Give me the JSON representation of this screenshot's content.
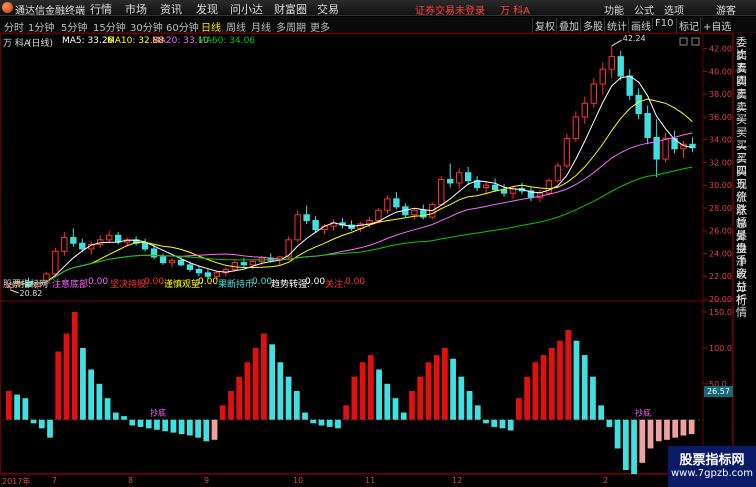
{
  "app": {
    "title": "通达信金融终端"
  },
  "menu": [
    "行情",
    "市场",
    "资讯",
    "发现",
    "问小达",
    "财富圈",
    "交易"
  ],
  "warning": "证券交易未登录",
  "stock_name_top": "万 科A",
  "right_menu": [
    "功能",
    "公式",
    "选项"
  ],
  "user_label": "游客",
  "period_tabs": [
    "分时",
    "1分钟",
    "5分钟",
    "15分钟",
    "30分钟",
    "60分钟",
    "日线",
    "周线",
    "月线",
    "多周期",
    "更多"
  ],
  "active_tab": "日线",
  "tools": [
    "复权",
    "叠加",
    "多股",
    "统计",
    "画线",
    "F10",
    "标记",
    "+自选"
  ],
  "ma_legend": {
    "stock": "万 科A",
    "period": "(日线)",
    "ma5": "MA5: 33.26",
    "ma10": "MA10: 32.88",
    "ma20": "MA20: 33.10",
    "ma60": "MA60: 34.06"
  },
  "indicator_legend": {
    "name": "股票指标网",
    "items": [
      {
        "label": "注意底部:",
        "value": "0.00",
        "color": "#ff66ff"
      },
      {
        "label": "坚决持股:",
        "value": "0.00",
        "color": "#ff3030"
      },
      {
        "label": "谨慎观望:",
        "value": "0.00",
        "color": "#ffff00"
      },
      {
        "label": "果断持币:",
        "value": "0.00",
        "color": "#40e0e0"
      },
      {
        "label": "趋势转强:",
        "value": "0.00",
        "color": "#ffffff"
      },
      {
        "label": "关注:",
        "value": "0.00",
        "color": "#ff3030"
      }
    ]
  },
  "price_axis": [
    "42.00",
    "40.00",
    "38.00",
    "36.00",
    "34.00",
    "32.00",
    "30.00",
    "28.00",
    "26.00",
    "24.00",
    "22.00",
    "20.00"
  ],
  "price_high_label": "42.24",
  "price_low_label": "20.82",
  "indicator_axis": [
    "150.0",
    "100.0",
    "50.0"
  ],
  "indicator_current": "26.57",
  "indicator_zero_markers": [
    "抄底",
    "抄底"
  ],
  "date_axis": [
    "2017年",
    "7",
    "8",
    "9",
    "10",
    "11",
    "12",
    "2"
  ],
  "sidebar_labels": [
    "委比",
    "卖五",
    "卖四",
    "卖三",
    "卖二",
    "卖一",
    "买一",
    "买二",
    "买三",
    "买四",
    "买五",
    "现价",
    "涨跌",
    "涨幅",
    "总量",
    "外盘",
    "换手",
    "净资",
    "收益",
    "分析",
    "行情"
  ],
  "watermark": {
    "line1": "股票指标网",
    "line2": "www.7gpzb.com"
  },
  "colors": {
    "up": "#ff3030",
    "down": "#40e0e0",
    "ma5": "#ffffff",
    "ma10": "#ffff00",
    "ma20": "#ff66ff",
    "ma60": "#00cc00"
  },
  "chart_data": {
    "type": "candlestick",
    "ylim": [
      20,
      42.5
    ],
    "candles": [
      [
        21.0,
        21.5,
        20.8,
        21.3
      ],
      [
        21.3,
        21.7,
        21.1,
        21.5
      ],
      [
        21.5,
        21.9,
        21.2,
        21.1
      ],
      [
        21.1,
        21.6,
        20.9,
        21.4
      ],
      [
        21.4,
        22.4,
        21.3,
        22.2
      ],
      [
        22.2,
        24.5,
        22.0,
        24.2
      ],
      [
        24.2,
        25.9,
        23.8,
        25.4
      ],
      [
        25.4,
        26.2,
        24.6,
        24.9
      ],
      [
        24.9,
        25.3,
        24.1,
        24.4
      ],
      [
        24.4,
        25.0,
        23.9,
        24.8
      ],
      [
        24.8,
        25.6,
        24.5,
        25.2
      ],
      [
        25.2,
        26.0,
        24.9,
        25.6
      ],
      [
        25.6,
        25.9,
        24.8,
        25.0
      ],
      [
        25.0,
        25.4,
        24.6,
        25.2
      ],
      [
        25.2,
        25.5,
        24.7,
        24.9
      ],
      [
        24.9,
        25.3,
        24.2,
        24.4
      ],
      [
        24.4,
        24.8,
        23.5,
        23.7
      ],
      [
        23.7,
        24.0,
        23.0,
        23.2
      ],
      [
        23.2,
        23.6,
        22.8,
        23.4
      ],
      [
        23.4,
        23.8,
        22.9,
        23.0
      ],
      [
        23.0,
        23.3,
        22.4,
        22.6
      ],
      [
        22.6,
        22.9,
        22.0,
        22.3
      ],
      [
        22.3,
        22.6,
        21.8,
        22.0
      ],
      [
        22.0,
        22.4,
        21.7,
        22.3
      ],
      [
        22.3,
        22.8,
        22.0,
        22.6
      ],
      [
        22.6,
        23.4,
        22.4,
        23.2
      ],
      [
        23.2,
        23.6,
        22.8,
        23.0
      ],
      [
        23.0,
        23.5,
        22.6,
        23.3
      ],
      [
        23.3,
        23.8,
        23.0,
        23.6
      ],
      [
        23.6,
        24.0,
        23.2,
        23.4
      ],
      [
        23.4,
        23.8,
        23.0,
        23.7
      ],
      [
        23.7,
        25.5,
        23.5,
        25.2
      ],
      [
        25.2,
        27.8,
        25.0,
        27.4
      ],
      [
        27.4,
        28.2,
        26.6,
        26.9
      ],
      [
        26.9,
        27.3,
        25.8,
        26.1
      ],
      [
        26.1,
        26.6,
        25.7,
        26.4
      ],
      [
        26.4,
        27.0,
        26.0,
        26.7
      ],
      [
        26.7,
        27.1,
        26.2,
        26.5
      ],
      [
        26.5,
        26.9,
        26.0,
        26.2
      ],
      [
        26.2,
        26.8,
        25.9,
        26.6
      ],
      [
        26.6,
        27.2,
        26.3,
        26.9
      ],
      [
        26.9,
        28.0,
        26.7,
        27.8
      ],
      [
        27.8,
        29.1,
        27.5,
        28.8
      ],
      [
        28.8,
        29.4,
        27.9,
        28.1
      ],
      [
        28.1,
        28.4,
        27.2,
        27.4
      ],
      [
        27.4,
        28.0,
        27.0,
        27.8
      ],
      [
        27.8,
        28.3,
        27.0,
        27.2
      ],
      [
        27.2,
        28.5,
        27.0,
        28.3
      ],
      [
        28.3,
        30.8,
        28.2,
        30.5
      ],
      [
        30.5,
        31.9,
        29.8,
        30.2
      ],
      [
        30.2,
        31.5,
        29.7,
        31.1
      ],
      [
        31.1,
        31.6,
        30.0,
        30.4
      ],
      [
        30.4,
        30.8,
        29.5,
        29.8
      ],
      [
        29.8,
        30.4,
        29.2,
        30.0
      ],
      [
        30.0,
        30.6,
        29.4,
        29.6
      ],
      [
        29.6,
        30.1,
        29.0,
        29.3
      ],
      [
        29.3,
        29.9,
        28.8,
        29.7
      ],
      [
        29.7,
        30.2,
        29.2,
        29.5
      ],
      [
        29.5,
        29.8,
        28.6,
        28.9
      ],
      [
        28.9,
        29.6,
        28.5,
        29.3
      ],
      [
        29.3,
        30.6,
        29.1,
        30.4
      ],
      [
        30.4,
        32.0,
        30.2,
        31.7
      ],
      [
        31.7,
        34.5,
        31.5,
        34.1
      ],
      [
        34.1,
        36.5,
        33.8,
        36.0
      ],
      [
        36.0,
        37.8,
        35.4,
        37.2
      ],
      [
        37.2,
        39.4,
        36.8,
        38.9
      ],
      [
        38.9,
        40.8,
        38.0,
        40.2
      ],
      [
        40.2,
        42.24,
        39.4,
        41.3
      ],
      [
        41.3,
        41.8,
        39.2,
        39.6
      ],
      [
        39.6,
        40.2,
        37.5,
        37.9
      ],
      [
        37.9,
        38.5,
        35.8,
        36.3
      ],
      [
        36.3,
        37.0,
        33.6,
        34.2
      ],
      [
        34.2,
        35.8,
        30.7,
        32.3
      ],
      [
        32.3,
        34.6,
        32.0,
        34.1
      ],
      [
        34.1,
        34.8,
        32.8,
        33.2
      ],
      [
        33.2,
        33.9,
        32.4,
        33.6
      ],
      [
        33.6,
        34.2,
        32.9,
        33.3
      ]
    ],
    "indicator": [
      40,
      35,
      30,
      -5,
      -12,
      -25,
      95,
      120,
      150,
      100,
      70,
      50,
      30,
      10,
      5,
      -8,
      -10,
      -12,
      -14,
      -16,
      -18,
      -20,
      -22,
      -25,
      -30,
      -28,
      20,
      40,
      60,
      80,
      100,
      120,
      105,
      80,
      60,
      40,
      10,
      -5,
      -8,
      -10,
      -12,
      20,
      60,
      80,
      90,
      70,
      50,
      30,
      10,
      40,
      60,
      80,
      90,
      100,
      85,
      60,
      40,
      20,
      -5,
      -10,
      -12,
      -15,
      30,
      60,
      80,
      90,
      100,
      110,
      125,
      110,
      90,
      60,
      20,
      -10,
      -40,
      -70,
      -90,
      -60,
      -40,
      -30,
      -28,
      -25,
      -22,
      -20
    ]
  }
}
